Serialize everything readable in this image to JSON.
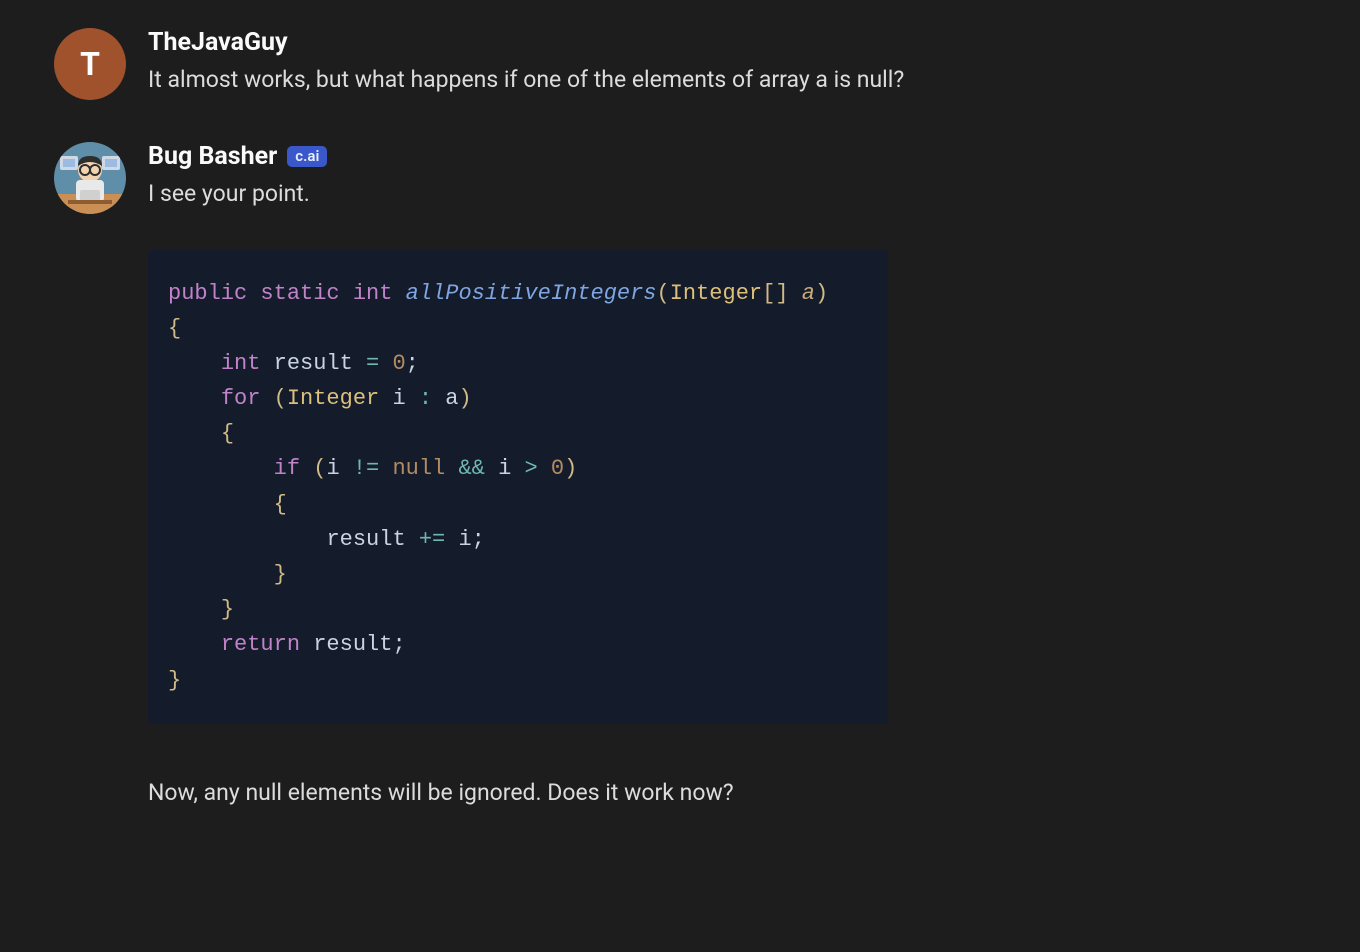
{
  "messages": [
    {
      "author": "TheJavaGuy",
      "avatar": {
        "type": "letter",
        "letter": "T",
        "bg": "#a0522d"
      },
      "badge": null,
      "text": "It almost works, but what happens if one of the elements of array a is null?"
    },
    {
      "author": "Bug Basher",
      "avatar": {
        "type": "svg"
      },
      "badge": "c.ai",
      "intro": "I see your point.",
      "outro": "Now, any null elements will be ignored. Does it work now?",
      "code": {
        "lang": "java",
        "lines": [
          "public static int allPositiveIntegers(Integer[] a)",
          "{",
          "    int result = 0;",
          "    for (Integer i : a)",
          "    {",
          "        if (i != null && i > 0)",
          "        {",
          "            result += i;",
          "        }",
          "    }",
          "    return result;",
          "}"
        ]
      }
    }
  ]
}
